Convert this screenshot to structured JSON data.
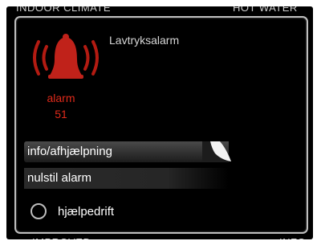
{
  "background": {
    "top_left": "INDOOR CLIMATE",
    "top_right": "HOT WATER"
  },
  "alarm": {
    "title": "Lavtryksalarm",
    "label": "alarm",
    "code": "51",
    "icon": "alarm-bell-icon",
    "color": "#e02a1a"
  },
  "menu": {
    "info_label": "info/afhjælpning",
    "reset_label": "nulstil alarm"
  },
  "option": {
    "label": "hjælpedrift",
    "selected": false
  }
}
